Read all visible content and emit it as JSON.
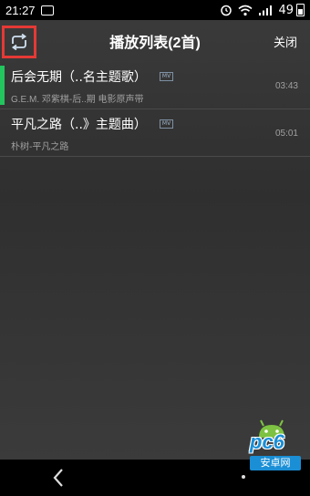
{
  "status_bar": {
    "time": "21:27",
    "battery": "49"
  },
  "header": {
    "title": "播放列表(2首)",
    "close_label": "关闭",
    "repeat_icon": "repeat-icon"
  },
  "playlist": [
    {
      "title": "后会无期（..名主题歌）",
      "badge": "MV",
      "subtitle": "G.E.M. 邓紫棋-后..期 电影原声带",
      "duration": "03:43",
      "active": true
    },
    {
      "title": "平凡之路（..》主题曲）",
      "badge": "MV",
      "subtitle": "朴树-平凡之路",
      "duration": "05:01",
      "active": false
    }
  ],
  "watermark": {
    "brand": "pc6",
    "sub": "安卓网"
  },
  "colors": {
    "active_indicator": "#22c55e",
    "highlight_box": "#e53935"
  }
}
